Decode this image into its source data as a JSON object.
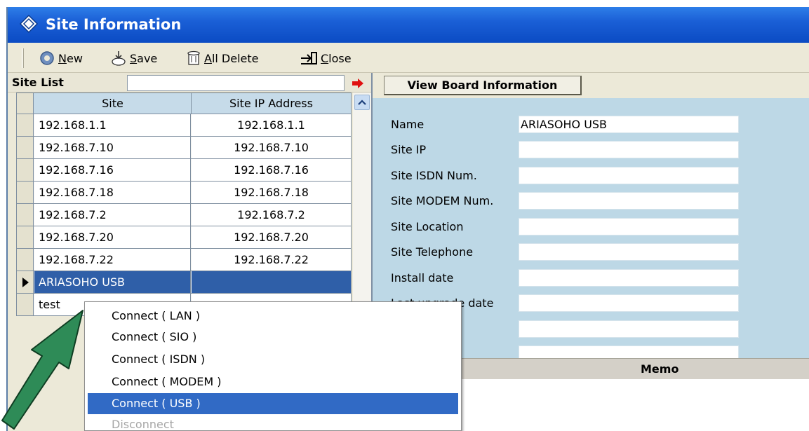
{
  "window": {
    "title": "Site Information",
    "icon": "diamond-icon"
  },
  "toolbar": {
    "new_prefix": "",
    "new_ul": "N",
    "new_rest": "ew",
    "save_ul": "S",
    "save_rest": "ave",
    "alldelete_ul": "A",
    "alldelete_rest": "ll Delete",
    "close_ul": "C",
    "close_rest": "lose"
  },
  "site_list": {
    "label": "Site List",
    "search_value": "",
    "columns": [
      "Site",
      "Site IP Address"
    ],
    "rows": [
      {
        "site": "192.168.1.1",
        "ip": "192.168.1.1"
      },
      {
        "site": "192.168.7.10",
        "ip": "192.168.7.10"
      },
      {
        "site": "192.168.7.16",
        "ip": "192.168.7.16"
      },
      {
        "site": "192.168.7.18",
        "ip": "192.168.7.18"
      },
      {
        "site": "192.168.7.2",
        "ip": "192.168.7.2"
      },
      {
        "site": "192.168.7.20",
        "ip": "192.168.7.20"
      },
      {
        "site": "192.168.7.22",
        "ip": "192.168.7.22"
      },
      {
        "site": "ARIASOHO USB",
        "ip": ""
      },
      {
        "site": "test",
        "ip": ""
      }
    ],
    "selected_index": 7
  },
  "board": {
    "button_label": "View Board Information",
    "fields": [
      {
        "label": "Name",
        "value": "ARIASOHO USB"
      },
      {
        "label": "Site IP",
        "value": ""
      },
      {
        "label": "Site ISDN Num.",
        "value": ""
      },
      {
        "label": "Site MODEM Num.",
        "value": ""
      },
      {
        "label": "Site Location",
        "value": ""
      },
      {
        "label": "Site Telephone",
        "value": ""
      },
      {
        "label": "Install date",
        "value": ""
      },
      {
        "label": "Last upgrade date",
        "value": ""
      },
      {
        "label": "",
        "value": ""
      },
      {
        "label": "",
        "value": ""
      }
    ],
    "memo_label": "Memo"
  },
  "context_menu": {
    "items": [
      {
        "label": "Connect ( LAN )",
        "state": "normal"
      },
      {
        "label": "Connect ( SIO )",
        "state": "normal"
      },
      {
        "label": "Connect ( ISDN )",
        "state": "normal"
      },
      {
        "label": "Connect ( MODEM )",
        "state": "normal"
      },
      {
        "label": "Connect ( USB )",
        "state": "hover"
      },
      {
        "label": "Disconnect",
        "state": "disabled"
      }
    ]
  },
  "colors": {
    "titlebar": "#0b4bc3",
    "selection": "#2f5fa8",
    "menu_highlight": "#316ac5",
    "panel_blue": "#bdd8e6",
    "annotation_arrow": "#2e8b57"
  }
}
